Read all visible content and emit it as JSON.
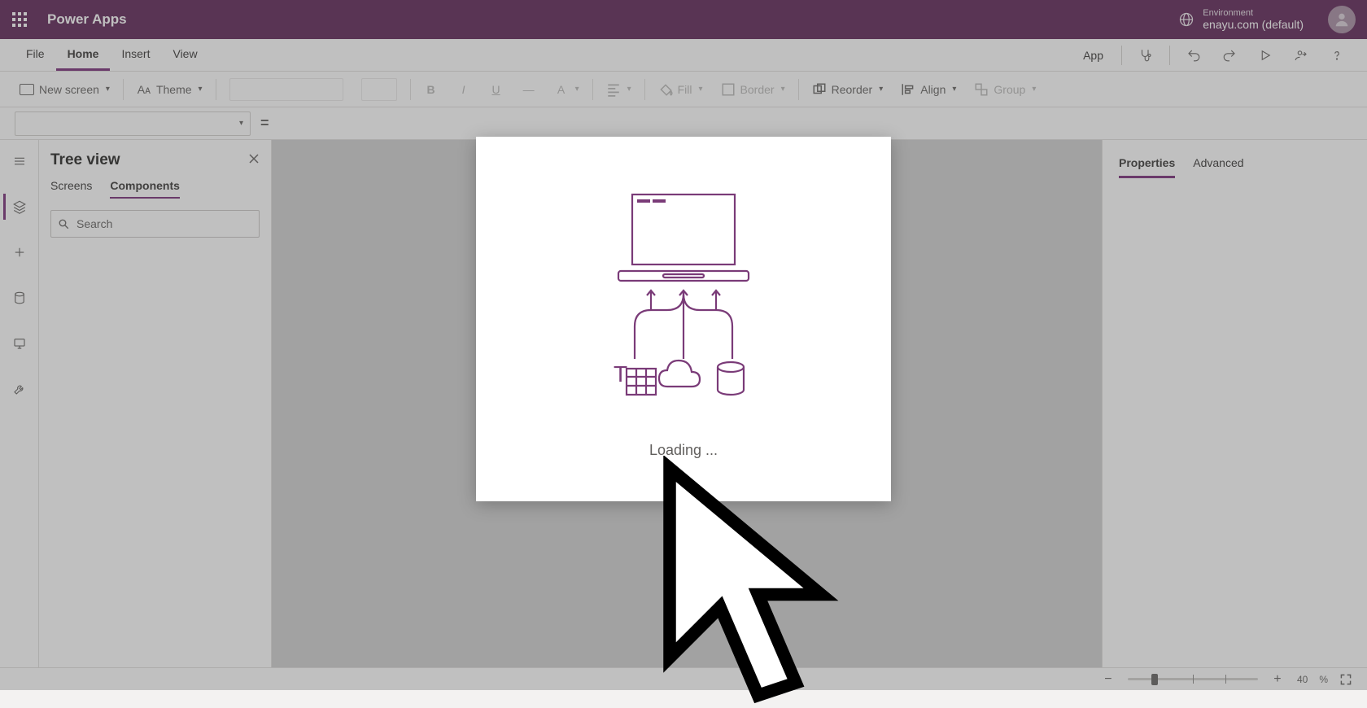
{
  "brand": "Power Apps",
  "environment": {
    "label": "Environment",
    "value": "enayu.com (default)"
  },
  "menu": {
    "file": "File",
    "home": "Home",
    "insert": "Insert",
    "view": "View",
    "app": "App"
  },
  "toolbar": {
    "new_screen": "New screen",
    "theme": "Theme",
    "fill": "Fill",
    "border": "Border",
    "reorder": "Reorder",
    "align": "Align",
    "group": "Group"
  },
  "formula": {
    "equals": "="
  },
  "tree": {
    "title": "Tree view",
    "tab_screens": "Screens",
    "tab_components": "Components",
    "search_placeholder": "Search"
  },
  "properties": {
    "tab_properties": "Properties",
    "tab_advanced": "Advanced"
  },
  "status": {
    "zoom_value": "40",
    "zoom_unit": "%"
  },
  "modal": {
    "loading": "Loading ..."
  }
}
